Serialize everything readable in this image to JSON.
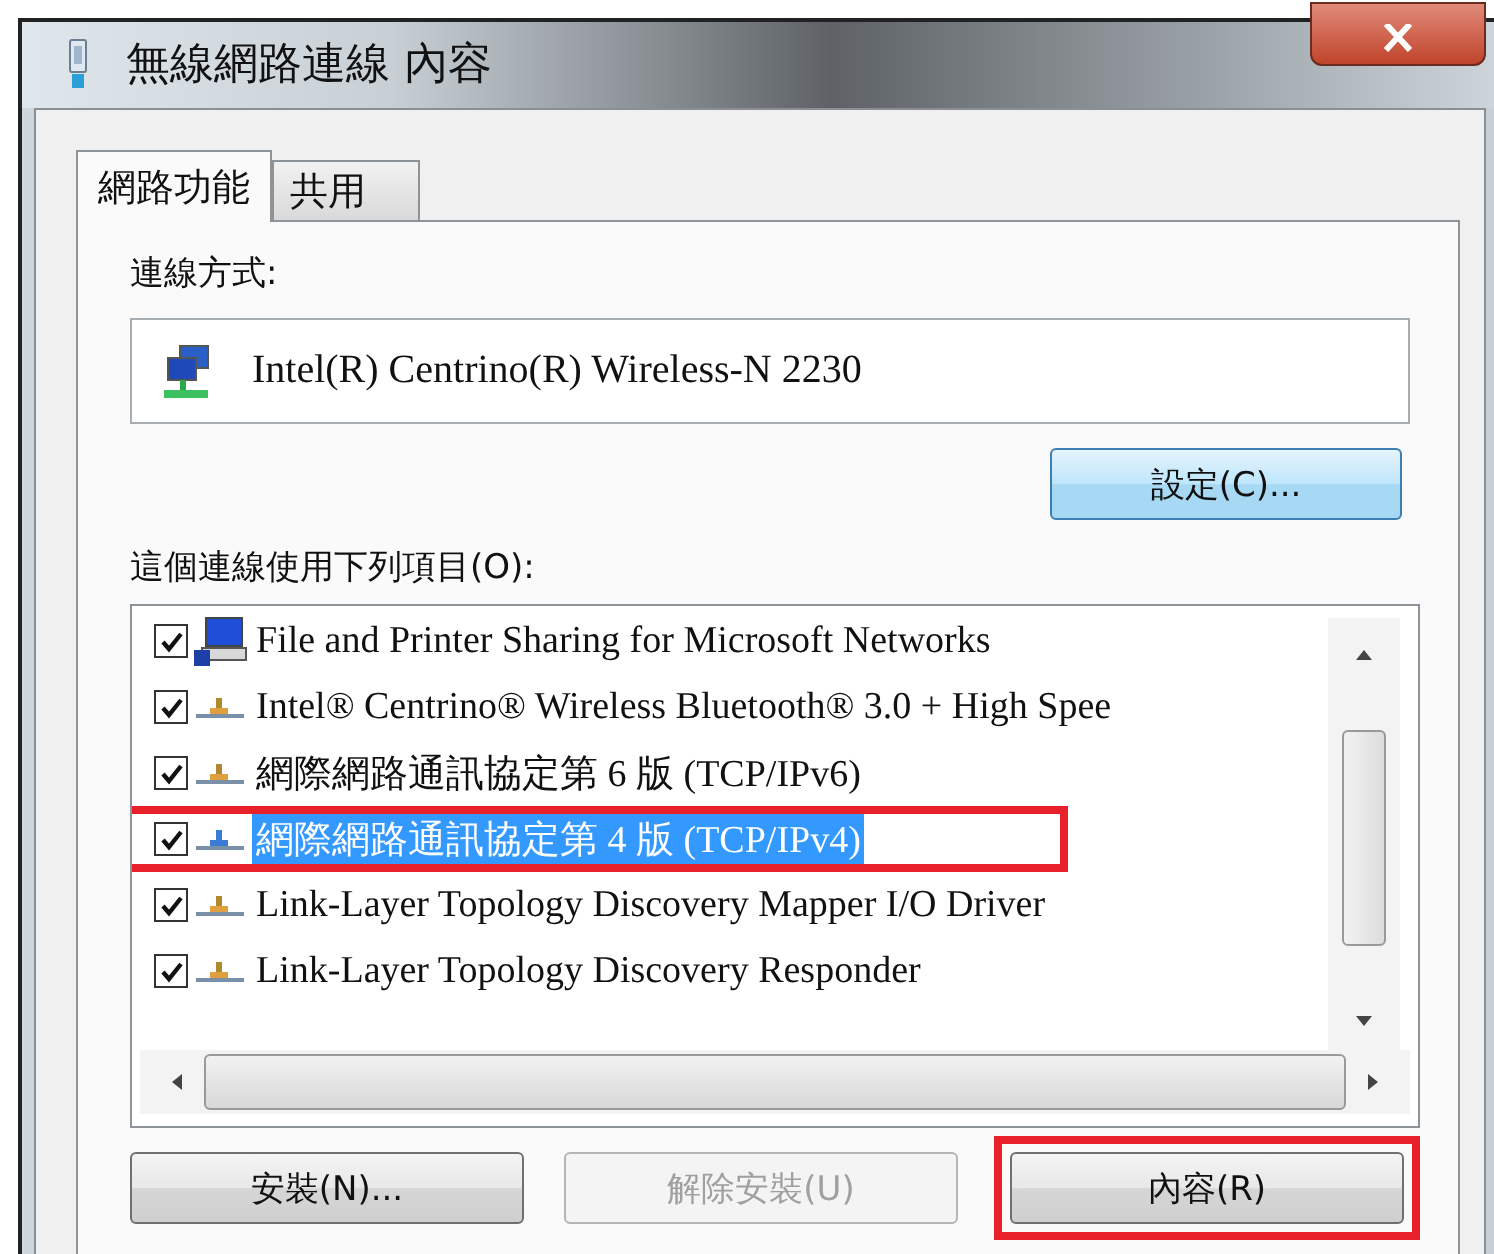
{
  "window": {
    "title": "無線網路連線 內容"
  },
  "tabs": [
    {
      "label": "網路功能",
      "selected": true
    },
    {
      "label": "共用",
      "selected": false
    }
  ],
  "connect_using": {
    "label": "連線方式:",
    "adapter": "Intel(R) Centrino(R) Wireless-N 2230",
    "configure_button": "設定(C)..."
  },
  "items": {
    "label": "這個連線使用下列項目(O):",
    "list": [
      {
        "kind": "service",
        "text": "File and Printer Sharing for Microsoft Networks",
        "checked": true,
        "selected": false,
        "highlighted": false
      },
      {
        "kind": "protocol",
        "text": "Intel® Centrino® Wireless Bluetooth® 3.0 + High Spee",
        "checked": true,
        "selected": false,
        "highlighted": false
      },
      {
        "kind": "protocol",
        "text": "網際網路通訊協定第 6 版 (TCP/IPv6)",
        "checked": true,
        "selected": false,
        "highlighted": false
      },
      {
        "kind": "protocol",
        "text": "網際網路通訊協定第 4 版 (TCP/IPv4)",
        "checked": true,
        "selected": true,
        "highlighted": true
      },
      {
        "kind": "protocol",
        "text": "Link-Layer Topology Discovery Mapper I/O Driver",
        "checked": true,
        "selected": false,
        "highlighted": false
      },
      {
        "kind": "protocol",
        "text": "Link-Layer Topology Discovery Responder",
        "checked": true,
        "selected": false,
        "highlighted": false
      }
    ]
  },
  "buttons": [
    {
      "label": "安裝(N)...",
      "disabled": false,
      "highlighted": false
    },
    {
      "label": "解除安裝(U)",
      "disabled": true,
      "highlighted": false
    },
    {
      "label": "內容(R)",
      "disabled": false,
      "highlighted": true
    }
  ]
}
